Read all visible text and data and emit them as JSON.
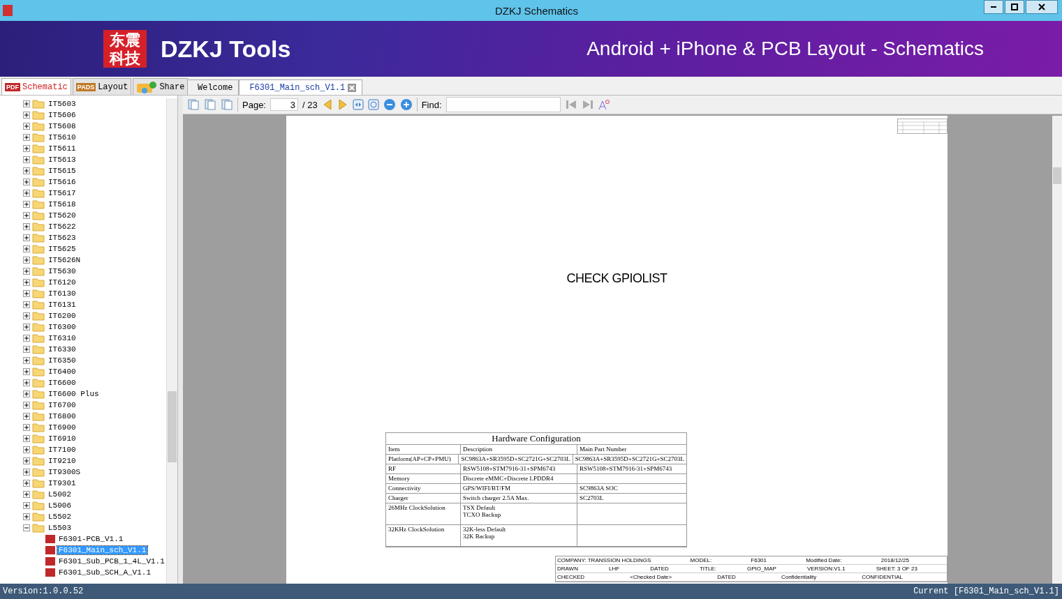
{
  "window": {
    "title": "DZKJ Schematics"
  },
  "banner": {
    "logo_chars": "东震科技",
    "brand": "DZKJ Tools",
    "tagline": "Android + iPhone & PCB Layout - Schematics"
  },
  "side_tabs": [
    {
      "label": "Schematic",
      "badge": "PDF",
      "selected": true
    },
    {
      "label": "Layout",
      "badge": "PADS",
      "selected": false
    },
    {
      "label": "Share",
      "selected": false
    }
  ],
  "doc_tabs": [
    {
      "label": "Welcome",
      "selected": false
    },
    {
      "label": "F6301_Main_sch_V1.1",
      "selected": true
    }
  ],
  "tree": [
    {
      "label": "IT5603",
      "expanded": false
    },
    {
      "label": "IT5606",
      "expanded": false
    },
    {
      "label": "IT5608",
      "expanded": false
    },
    {
      "label": "IT5610",
      "expanded": false
    },
    {
      "label": "IT5611",
      "expanded": false
    },
    {
      "label": "IT5613",
      "expanded": false
    },
    {
      "label": "IT5615",
      "expanded": false
    },
    {
      "label": "IT5616",
      "expanded": false
    },
    {
      "label": "IT5617",
      "expanded": false
    },
    {
      "label": "IT5618",
      "expanded": false
    },
    {
      "label": "IT5620",
      "expanded": false
    },
    {
      "label": "IT5622",
      "expanded": false
    },
    {
      "label": "IT5623",
      "expanded": false
    },
    {
      "label": "IT5625",
      "expanded": false
    },
    {
      "label": "IT5626N",
      "expanded": false
    },
    {
      "label": "IT5630",
      "expanded": false
    },
    {
      "label": "IT6120",
      "expanded": false
    },
    {
      "label": "IT6130",
      "expanded": false
    },
    {
      "label": "IT6131",
      "expanded": false
    },
    {
      "label": "IT6200",
      "expanded": false
    },
    {
      "label": "IT6300",
      "expanded": false
    },
    {
      "label": "IT6310",
      "expanded": false
    },
    {
      "label": "IT6330",
      "expanded": false
    },
    {
      "label": "IT6350",
      "expanded": false
    },
    {
      "label": "IT6400",
      "expanded": false
    },
    {
      "label": "IT6600",
      "expanded": false
    },
    {
      "label": "IT6600 Plus",
      "expanded": false
    },
    {
      "label": "IT6700",
      "expanded": false
    },
    {
      "label": "IT6800",
      "expanded": false
    },
    {
      "label": "IT6900",
      "expanded": false
    },
    {
      "label": "IT6910",
      "expanded": false
    },
    {
      "label": "IT7100",
      "expanded": false
    },
    {
      "label": "IT9210",
      "expanded": false
    },
    {
      "label": "IT9300S",
      "expanded": false
    },
    {
      "label": "IT9301",
      "expanded": false
    },
    {
      "label": "L5002",
      "expanded": false
    },
    {
      "label": "L5006",
      "expanded": false
    },
    {
      "label": "L5502",
      "expanded": false
    },
    {
      "label": "L5503",
      "expanded": true,
      "children": [
        {
          "label": "F6301-PCB_V1.1",
          "selected": false
        },
        {
          "label": "F6301_Main_sch_V1.1",
          "selected": true
        },
        {
          "label": "F6301_Sub_PCB_1_4L_V1.1",
          "selected": false
        },
        {
          "label": "F6301_Sub_SCH_A_V1.1",
          "selected": false
        }
      ]
    }
  ],
  "toolbar": {
    "page_label": "Page:",
    "page_value": "3",
    "page_total": "/ 23",
    "find_label": "Find:"
  },
  "sheet": {
    "heading": "CHECK GPIOLIST",
    "hw_table": {
      "title": "Hardware Configuration",
      "columns": [
        "Item",
        "Description",
        "Main Part Number"
      ],
      "rows": [
        {
          "item": "Platform(AP+CP+PMU)",
          "description": [
            "SC9863A+SR3595D+SC2721G+SC2703L"
          ],
          "part": "SC9863A+SR3595D+SC2721G+SC2703L"
        },
        {
          "item": "RF",
          "description": [
            "RSW5108+STM7916-31+SPM6743"
          ],
          "part": "RSW5108+STM7916-31+SPM6743"
        },
        {
          "item": "Memory",
          "description": [
            "Discrete eMMC+Discrete LPDDR4"
          ]
        },
        {
          "item": "Connectivity",
          "description": [
            "GPS/WIFI/BT/FM"
          ],
          "part": "SC9863A SOC"
        },
        {
          "item": "Charger",
          "description": [
            "Switch charger 2.5A Max."
          ],
          "part": "SC2703L"
        },
        {
          "item": "26MHz ClockSolution",
          "description": [
            "TSX Default",
            "TCXO Backup"
          ]
        },
        {
          "item": "32KHz ClockSolution",
          "description": [
            "32K-less Default",
            "32K Backup"
          ]
        }
      ]
    },
    "title_block": [
      [
        "COMPANY: TRANSSION HOLDINGS",
        "MODEL:",
        "F6301",
        "Modified Date:",
        "2018/12/25"
      ],
      [
        "DRAWN",
        "LHF",
        "DATED",
        "TITLE:",
        "GPIO_MAP",
        "VERSION:V1.1",
        "SHEET: 3  OF  23"
      ],
      [
        "CHECKED",
        "<Checked Date>",
        "DATED",
        "Confidentiality",
        "CONFIDENTIAL"
      ]
    ]
  },
  "status_bar": {
    "version": "Version:1.0.0.52",
    "current": "Current [F6301_Main_sch_V1.1]"
  }
}
